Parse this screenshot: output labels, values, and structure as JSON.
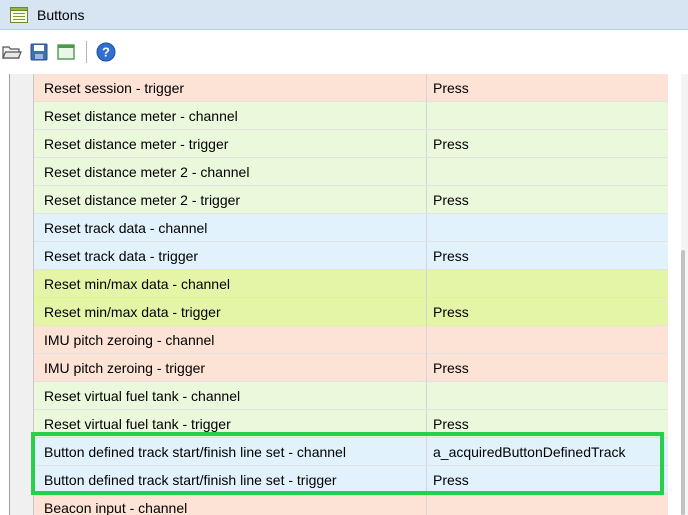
{
  "window": {
    "title": "Buttons",
    "title_icon": "list-window-icon"
  },
  "toolbar": {
    "buttons": [
      {
        "name": "open-folder-icon",
        "tooltip": ""
      },
      {
        "name": "save-icon",
        "tooltip": ""
      },
      {
        "name": "window-icon",
        "tooltip": ""
      },
      {
        "name": "help-icon",
        "tooltip": ""
      }
    ]
  },
  "colors": {
    "title_bar": "#d7e4f2",
    "row_salmon": "#fde3d6",
    "row_green": "#eaf8dc",
    "row_blue": "#e2f2fc",
    "row_yellow": "#e5f5a8",
    "highlight_border": "#26d04a"
  },
  "rows": [
    {
      "name": "Reset session - trigger",
      "value": "Press",
      "color": "#fde3d6"
    },
    {
      "name": "Reset distance meter - channel",
      "value": "",
      "color": "#eaf8dc"
    },
    {
      "name": "Reset distance meter - trigger",
      "value": "Press",
      "color": "#eaf8dc"
    },
    {
      "name": "Reset distance meter 2 - channel",
      "value": "",
      "color": "#eaf8dc"
    },
    {
      "name": "Reset distance meter 2 - trigger",
      "value": "Press",
      "color": "#eaf8dc"
    },
    {
      "name": "Reset track data - channel",
      "value": "",
      "color": "#e2f2fc"
    },
    {
      "name": "Reset track data - trigger",
      "value": "Press",
      "color": "#e2f2fc"
    },
    {
      "name": "Reset min/max data - channel",
      "value": "",
      "color": "#e5f5a8"
    },
    {
      "name": "Reset min/max data - trigger",
      "value": "Press",
      "color": "#e5f5a8"
    },
    {
      "name": "IMU pitch zeroing - channel",
      "value": "",
      "color": "#fde3d6"
    },
    {
      "name": "IMU pitch zeroing - trigger",
      "value": "Press",
      "color": "#fde3d6"
    },
    {
      "name": "Reset virtual fuel tank - channel",
      "value": "",
      "color": "#eaf8dc"
    },
    {
      "name": "Reset virtual fuel tank - trigger",
      "value": "Press",
      "color": "#eaf8dc"
    },
    {
      "name": "Button defined track start/finish line set - channel",
      "value": "a_acquiredButtonDefinedTrack",
      "color": "#e2f2fc"
    },
    {
      "name": "Button defined track start/finish line set - trigger",
      "value": "Press",
      "color": "#e2f2fc"
    },
    {
      "name": "Beacon input - channel",
      "value": "",
      "color": "#fde3d6"
    }
  ]
}
